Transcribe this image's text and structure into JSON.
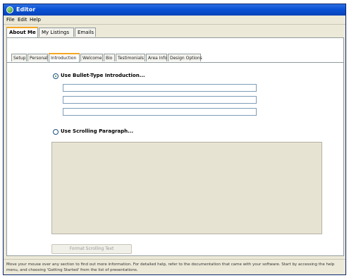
{
  "window": {
    "title": "Editor"
  },
  "menu": [
    "File",
    "Edit",
    "Help"
  ],
  "top_tabs": [
    "About Me",
    "My Listings",
    "Emails"
  ],
  "sub_tabs": [
    "Setup",
    "Personal",
    "Introduction",
    "Welcome",
    "Bio",
    "Testimonials",
    "Area Info",
    "Design Options"
  ],
  "intro": {
    "bullet_option_label": "Use Bullet-Type Introduction...",
    "scroll_option_label": "Use Scrolling Paragraph...",
    "bullet_values": [
      "",
      "",
      ""
    ],
    "paragraph_value": "",
    "button_label": "Format Scrolling Text"
  },
  "footer": {
    "text": "Move your mouse over any section to find out more information. For detailed help, refer to the documentation that came with your software. Start by accessing the help menu, and choosing 'Getting Started' from the list of presentations."
  },
  "colors": {
    "titlebar": "#0A52D6",
    "window_bg": "#ECE9D8",
    "tab_highlight": "#F5A623",
    "paragraph_bg": "#E6E3D3"
  }
}
